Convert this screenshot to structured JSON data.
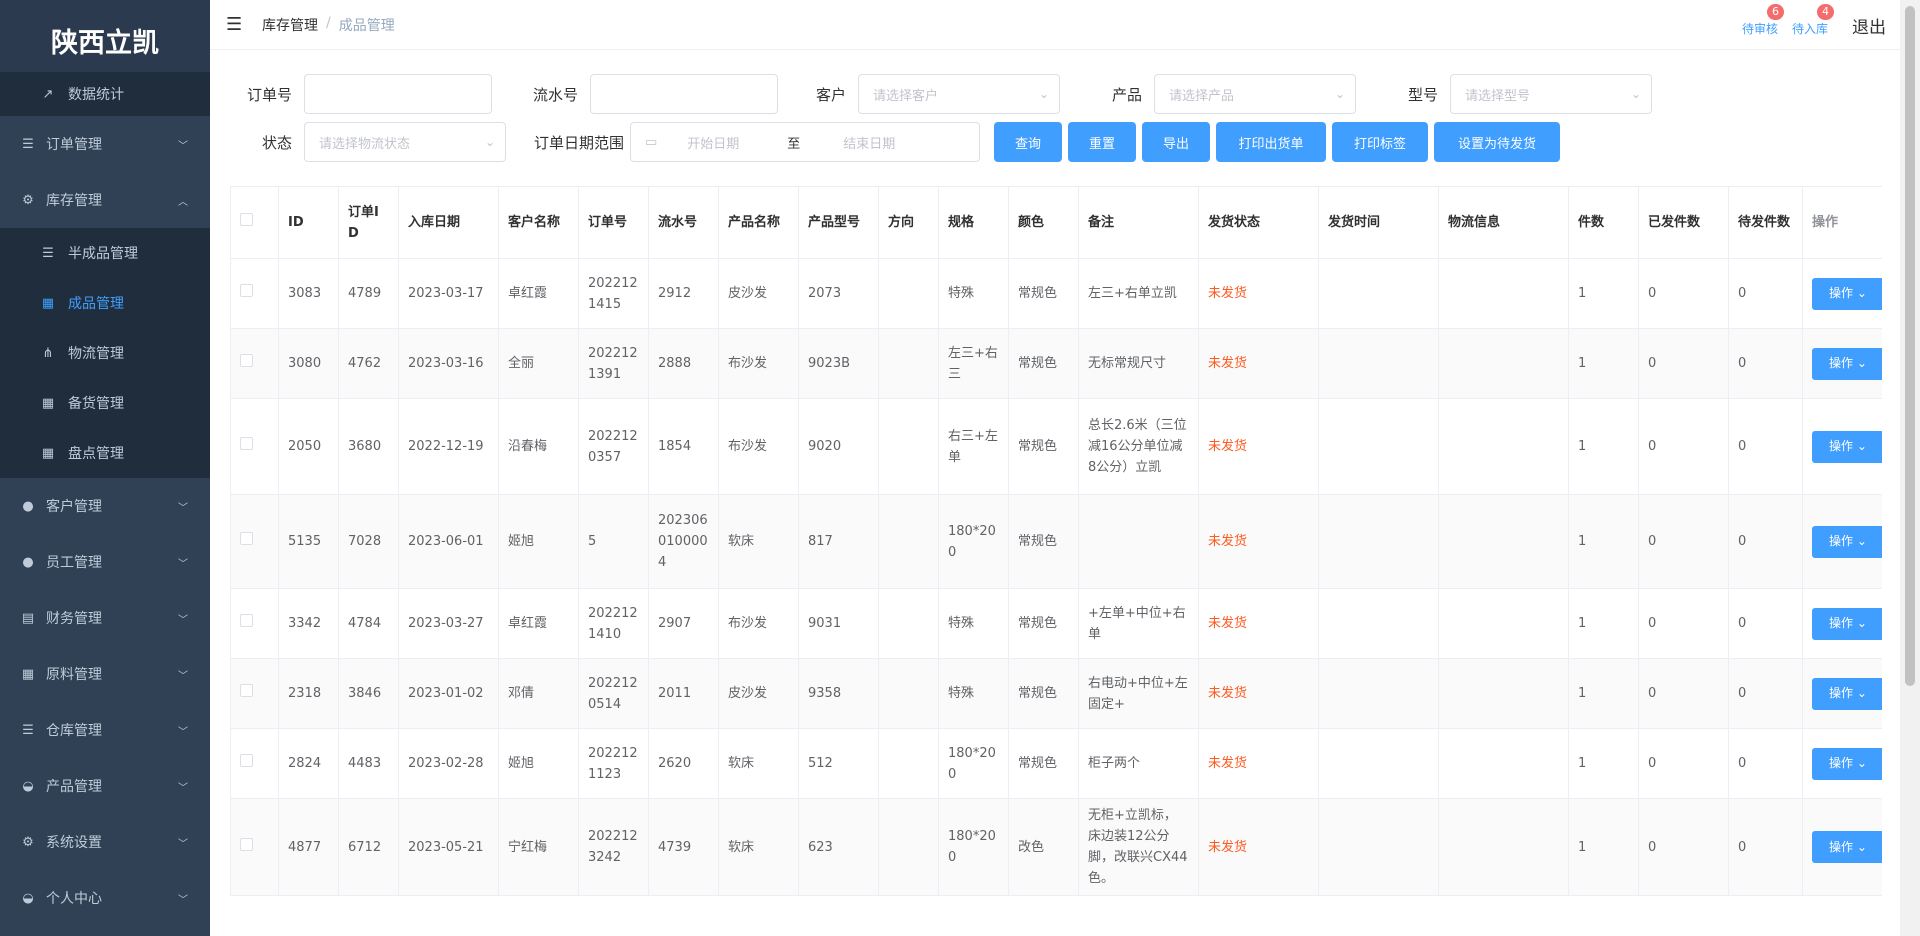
{
  "app": {
    "title": "陕西立凯"
  },
  "sidebar": {
    "top_item": {
      "label": "数据统计",
      "icon": "external-link-icon"
    },
    "menus": [
      {
        "label": "订单管理",
        "icon": "list-icon"
      },
      {
        "label": "库存管理",
        "icon": "gear-icon",
        "expanded": true
      },
      {
        "label": "客户管理",
        "icon": "user-icon"
      },
      {
        "label": "员工管理",
        "icon": "user-icon"
      },
      {
        "label": "财务管理",
        "icon": "document-icon"
      },
      {
        "label": "原料管理",
        "icon": "grid-icon"
      },
      {
        "label": "仓库管理",
        "icon": "list-icon"
      },
      {
        "label": "产品管理",
        "icon": "dashboard-icon"
      },
      {
        "label": "系统设置",
        "icon": "gear-icon"
      },
      {
        "label": "个人中心",
        "icon": "dashboard-icon"
      }
    ],
    "submenu": [
      {
        "label": "半成品管理",
        "icon": "list-icon"
      },
      {
        "label": "成品管理",
        "icon": "grid-icon",
        "active": true
      },
      {
        "label": "物流管理",
        "icon": "tree-icon"
      },
      {
        "label": "备货管理",
        "icon": "grid-icon"
      },
      {
        "label": "盘点管理",
        "icon": "grid-icon"
      }
    ]
  },
  "navbar": {
    "breadcrumb": [
      "库存管理",
      "成品管理"
    ],
    "pending_review": {
      "label": "待审核",
      "count": "6"
    },
    "pending_stock": {
      "label": "待入库",
      "count": "4"
    },
    "logout": "退出"
  },
  "filters": {
    "order_no": {
      "label": "订单号",
      "value": ""
    },
    "serial_no": {
      "label": "流水号",
      "value": ""
    },
    "customer": {
      "label": "客户",
      "placeholder": "请选择客户"
    },
    "product": {
      "label": "产品",
      "placeholder": "请选择产品"
    },
    "model": {
      "label": "型号",
      "placeholder": "请选择型号"
    },
    "status": {
      "label": "状态",
      "placeholder": "请选择物流状态"
    },
    "date_range": {
      "label": "订单日期范围",
      "start": "开始日期",
      "sep": "至",
      "end": "结束日期"
    },
    "buttons": [
      "查询",
      "重置",
      "导出",
      "打印出货单",
      "打印标签",
      "设置为待发货"
    ]
  },
  "table": {
    "columns": [
      "ID",
      "订单ID",
      "入库日期",
      "客户名称",
      "订单号",
      "流水号",
      "产品名称",
      "产品型号",
      "方向",
      "规格",
      "颜色",
      "备注",
      "发货状态",
      "发货时间",
      "物流信息",
      "件数",
      "已发件数",
      "待发件数",
      "操作"
    ],
    "op_label": "操作",
    "rows": [
      [
        "3083",
        "4789",
        "2023-03-17",
        "卓红霞",
        "2022121415",
        "2912",
        "皮沙发",
        "2073",
        "",
        "特殊",
        "常规色",
        "左三+右单立凯",
        "未发货",
        "",
        "",
        "1",
        "0",
        "0"
      ],
      [
        "3080",
        "4762",
        "2023-03-16",
        "全丽",
        "2022121391",
        "2888",
        "布沙发",
        "9023B",
        "",
        "左三+右三",
        "常规色",
        "无标常规尺寸",
        "未发货",
        "",
        "",
        "1",
        "0",
        "0"
      ],
      [
        "2050",
        "3680",
        "2022-12-19",
        "沿春梅",
        "2022120357",
        "1854",
        "布沙发",
        "9020",
        "",
        "右三+左单",
        "常规色",
        "总长2.6米（三位减16公分单位减8公分）立凯",
        "未发货",
        "",
        "",
        "1",
        "0",
        "0"
      ],
      [
        "5135",
        "7028",
        "2023-06-01",
        "姬旭",
        "5",
        "2023060100004",
        "软床",
        "817",
        "",
        "180*200",
        "常规色",
        "",
        "未发货",
        "",
        "",
        "1",
        "0",
        "0"
      ],
      [
        "3342",
        "4784",
        "2023-03-27",
        "卓红霞",
        "2022121410",
        "2907",
        "布沙发",
        "9031",
        "",
        "特殊",
        "常规色",
        "+左单+中位+右单",
        "未发货",
        "",
        "",
        "1",
        "0",
        "0"
      ],
      [
        "2318",
        "3846",
        "2023-01-02",
        "邓倩",
        "2022120514",
        "2011",
        "皮沙发",
        "9358",
        "",
        "特殊",
        "常规色",
        "右电动+中位+左固定+",
        "未发货",
        "",
        "",
        "1",
        "0",
        "0"
      ],
      [
        "2824",
        "4483",
        "2023-02-28",
        "姬旭",
        "2022121123",
        "2620",
        "软床",
        "512",
        "",
        "180*200",
        "常规色",
        "柜子两个",
        "未发货",
        "",
        "",
        "1",
        "0",
        "0"
      ],
      [
        "4877",
        "6712",
        "2023-05-21",
        "宁红梅",
        "2022123242",
        "4739",
        "软床",
        "623",
        "",
        "180*200",
        "改色",
        "无柜+立凯标，床边装12公分脚，改联兴CX44色。",
        "未发货",
        "",
        "",
        "1",
        "0",
        "0"
      ]
    ]
  },
  "colors": {
    "sidebar_bg": "#304156",
    "accent": "#409eff",
    "status": "#ff5a1f"
  }
}
